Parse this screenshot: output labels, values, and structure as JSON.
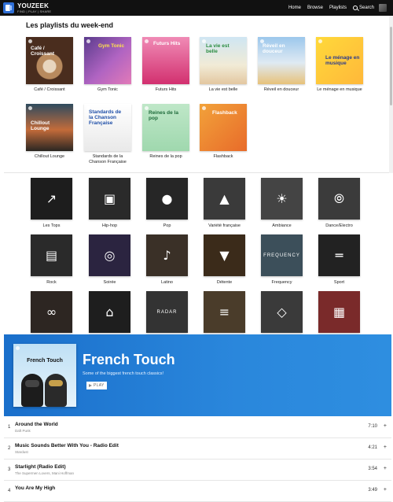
{
  "header": {
    "brand_name": "YOUZEEK",
    "brand_tagline": "FIND | PLAY | SHARE",
    "nav": [
      "Home",
      "Browse",
      "Playlists"
    ],
    "search_label": "Search"
  },
  "weekend": {
    "title": "Les playlists du week-end",
    "playlists": [
      {
        "title": "Café / Croissant",
        "cover_text": "Café / Croissant"
      },
      {
        "title": "Gym Tonic",
        "cover_text": "Gym Tonic"
      },
      {
        "title": "Futurs Hits",
        "cover_text": "Futurs Hits"
      },
      {
        "title": "La vie est belle",
        "cover_text": "La vie est belle"
      },
      {
        "title": "Réveil en douceur",
        "cover_text": "Réveil en douceur"
      },
      {
        "title": "Le ménage en musique",
        "cover_text": "Le ménage en musique"
      },
      {
        "title": "Chillout Lounge",
        "cover_text": "Chillout Lounge"
      },
      {
        "title": "Standards de la Chanson Française",
        "cover_text": "Standards de la Chanson Française"
      },
      {
        "title": "Reines de la pop",
        "cover_text": "Reines de la pop"
      },
      {
        "title": "Flashback",
        "cover_text": "Flashback"
      }
    ]
  },
  "genres": [
    {
      "label": "Les Tops",
      "icon": "chart-up-icon"
    },
    {
      "label": "Hip-hop",
      "icon": "boombox-icon"
    },
    {
      "label": "Pop",
      "icon": "microphone-icon"
    },
    {
      "label": "Variété française",
      "icon": "paris-icon"
    },
    {
      "label": "Ambiance",
      "icon": "sun-cloud-icon"
    },
    {
      "label": "Dance/Electro",
      "icon": "cassette-icon"
    },
    {
      "label": "Rock",
      "icon": "amplifier-icon"
    },
    {
      "label": "Soirée",
      "icon": "disco-ball-icon"
    },
    {
      "label": "Latino",
      "icon": "guitar-icon"
    },
    {
      "label": "Détente",
      "icon": "cat-icon"
    },
    {
      "label": "Frequency",
      "icon": "frequency-icon",
      "tile_text": "FREQUENCY"
    },
    {
      "label": "Sport",
      "icon": "dumbbell-icon"
    },
    {
      "label": "",
      "icon": "glasses-icon"
    },
    {
      "label": "",
      "icon": "house-icon"
    },
    {
      "label": "",
      "icon": "radar-icon",
      "tile_text": "RADAR"
    },
    {
      "label": "",
      "icon": "bed-icon"
    },
    {
      "label": "",
      "icon": "mask-icon"
    },
    {
      "label": "",
      "icon": "calendar-icon"
    }
  ],
  "feature": {
    "cover_title": "French Touch",
    "title": "French Touch",
    "description": "Some of the biggest french touch classics!",
    "play_label": "PLAY"
  },
  "tracks": [
    {
      "num": "1",
      "title": "Around the World",
      "artist": "Daft Punk",
      "duration": "7:10"
    },
    {
      "num": "2",
      "title": "Music Sounds Better With You - Radio Edit",
      "artist": "Stardust",
      "duration": "4:21"
    },
    {
      "num": "3",
      "title": "Starlight (Radio Edit)",
      "artist": "The Supermen Lovers, Mani Hoffman",
      "duration": "3:54"
    },
    {
      "num": "4",
      "title": "You Are My High",
      "artist": "",
      "duration": "3:49"
    }
  ],
  "colors": {
    "header_bg": "#111111",
    "banner_blue": "#2a87dc"
  }
}
